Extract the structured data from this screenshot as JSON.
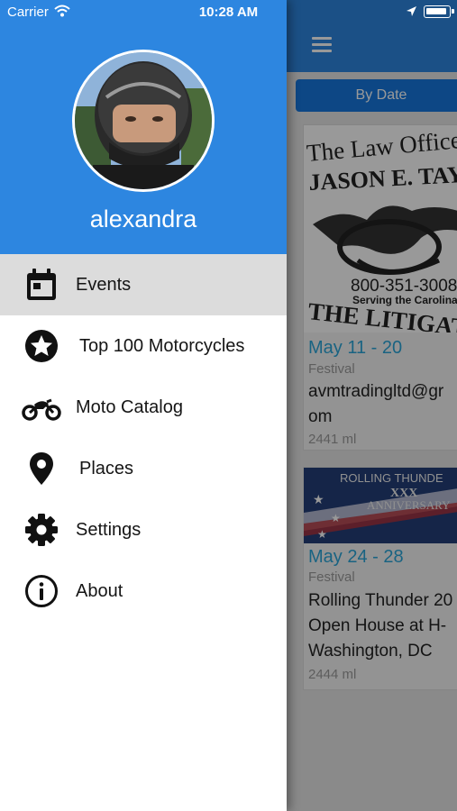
{
  "status_bar": {
    "carrier": "Carrier",
    "time": "10:28 AM",
    "icons": [
      "wifi-icon",
      "location-arrow-icon",
      "battery-icon"
    ]
  },
  "drawer": {
    "header_color": "#2d86e0",
    "username": "alexandra",
    "selected_index": 0,
    "items": [
      {
        "label": "Events",
        "icon": "calendar-icon"
      },
      {
        "label": "Top 100 Motorcycles",
        "icon": "star-icon"
      },
      {
        "label": "Moto Catalog",
        "icon": "motorcycle-icon"
      },
      {
        "label": "Places",
        "icon": "map-pin-icon"
      },
      {
        "label": "Settings",
        "icon": "gear-icon"
      },
      {
        "label": "About",
        "icon": "info-icon"
      }
    ]
  },
  "background_app": {
    "menu_icon": "hamburger-icon",
    "segment_label": "By Date",
    "accent_color": "#2aa6d9",
    "cards": [
      {
        "image_text": [
          "The Law Offices",
          "JASON E. TAY",
          "800-351-3008",
          "Serving the Carolinas",
          "THE LITIGATOR"
        ],
        "date": "May 11 - 20",
        "type": "Festival",
        "title_lines": [
          "avmtradingltd@gr",
          "om"
        ],
        "distance": "2441 ml"
      },
      {
        "image_text": [
          "ROLLING THUNDE",
          "XXX",
          "ANNIVERSARY"
        ],
        "date": "May 24 - 28",
        "type": "Festival",
        "title_lines": [
          "Rolling Thunder 20",
          "Open House at H-",
          "Washington, DC"
        ],
        "distance": "2444 ml"
      }
    ]
  }
}
